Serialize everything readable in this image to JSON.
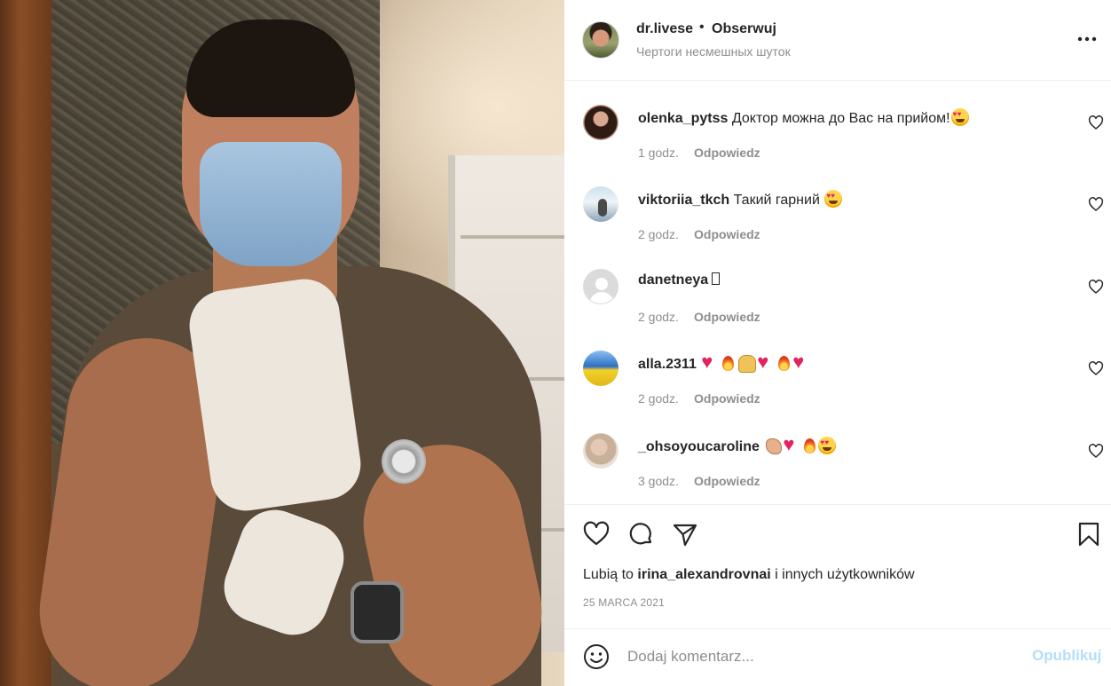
{
  "post": {
    "username": "dr.livese",
    "separator": "•",
    "follow_label": "Obserwuj",
    "subtitle": "Чертоги несмешных шуток",
    "more_icon": "more-horizontal-icon"
  },
  "comments": [
    {
      "user": "olenka_pytss",
      "text": "Доктор можна до Вас на прийом!",
      "time": "1 godz.",
      "reply": "Odpowiedz"
    },
    {
      "user": "viktoriia_tkch",
      "text": "Такий гарний",
      "time": "2 godz.",
      "reply": "Odpowiedz"
    },
    {
      "user": "danetneya",
      "text": "",
      "time": "2 godz.",
      "reply": "Odpowiedz"
    },
    {
      "user": "alla.2311",
      "text": "",
      "time": "2 godz.",
      "reply": "Odpowiedz"
    },
    {
      "user": "_ohsoyoucaroline",
      "text": "",
      "time": "3 godz.",
      "reply": "Odpowiedz"
    }
  ],
  "likes": {
    "prefix": "Lubią to",
    "user": "irina_alexandrovnai",
    "suffix": "i innych użytkowników"
  },
  "date": "25 MARCA 2021",
  "add_comment": {
    "placeholder": "Dodaj komentarz...",
    "publish_label": "Opublikuj"
  },
  "colors": {
    "text": "#262626",
    "secondary": "#8e8e8e",
    "publish_disabled": "#b2dffc",
    "divider": "#efefef",
    "heart_emoji": "#e0245e"
  }
}
